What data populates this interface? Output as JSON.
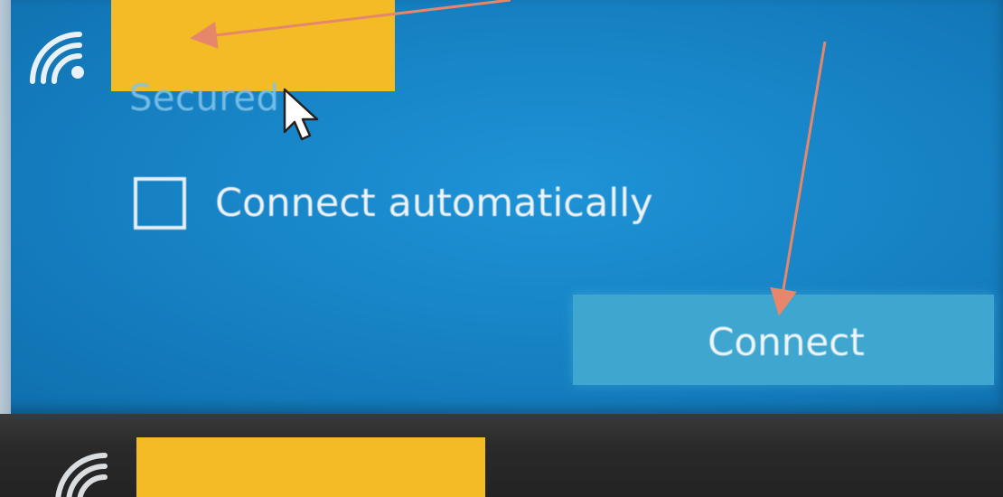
{
  "network_list": {
    "selected": {
      "name_redacted": true,
      "status": "Secured",
      "auto_connect_label": "Connect automatically",
      "auto_connect_checked": false,
      "connect_button_label": "Connect"
    },
    "next": {
      "name_redacted": true
    }
  },
  "colors": {
    "panel_blue": "#1784c6",
    "button_blue": "#3fa6cf",
    "redaction": "#f3bb26",
    "annotation_arrow": "#e6866a"
  },
  "icons": {
    "wifi": "wifi-signal-icon",
    "cursor": "mouse-pointer-icon"
  }
}
